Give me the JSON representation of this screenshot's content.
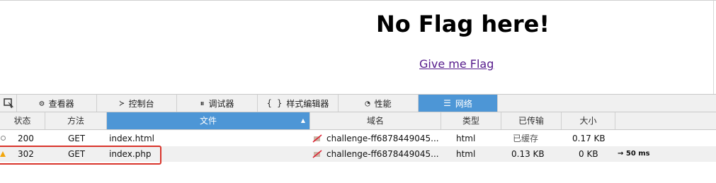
{
  "page": {
    "heading": "No Flag here!",
    "link": "Give me Flag"
  },
  "toolbar": {
    "tools": [
      {
        "name": "inspector",
        "icon": "inspector-icon",
        "label": "查看器"
      },
      {
        "name": "console",
        "icon": "console-icon",
        "label": "控制台"
      },
      {
        "name": "debugger",
        "icon": "debugger-icon",
        "label": "调试器"
      },
      {
        "name": "style-editor",
        "icon": "braces-icon",
        "label": "样式编辑器"
      },
      {
        "name": "performance",
        "icon": "performance-icon",
        "label": "性能"
      },
      {
        "name": "network",
        "icon": "network-icon",
        "label": "网络",
        "active": true
      }
    ]
  },
  "network": {
    "columns": {
      "status": "状态",
      "method": "方法",
      "file": "文件",
      "domain": "域名",
      "type": "类型",
      "transferred": "已传输",
      "size": "大小"
    },
    "rows": [
      {
        "status": "200",
        "method": "GET",
        "file": "index.html",
        "domain": "challenge-ff6878449045...",
        "type": "html",
        "transferred": "已缓存",
        "size": "0.17 KB",
        "timing": ""
      },
      {
        "status": "302",
        "method": "GET",
        "file": "index.php",
        "domain": "challenge-ff6878449045...",
        "type": "html",
        "transferred": "0.13 KB",
        "size": "0 KB",
        "timing": "→ 50 ms"
      }
    ]
  },
  "colors": {
    "active_tab": "#4d96d6",
    "highlight_box": "#d9342b",
    "warning": "#f2a60c",
    "link": "#551a8b"
  }
}
